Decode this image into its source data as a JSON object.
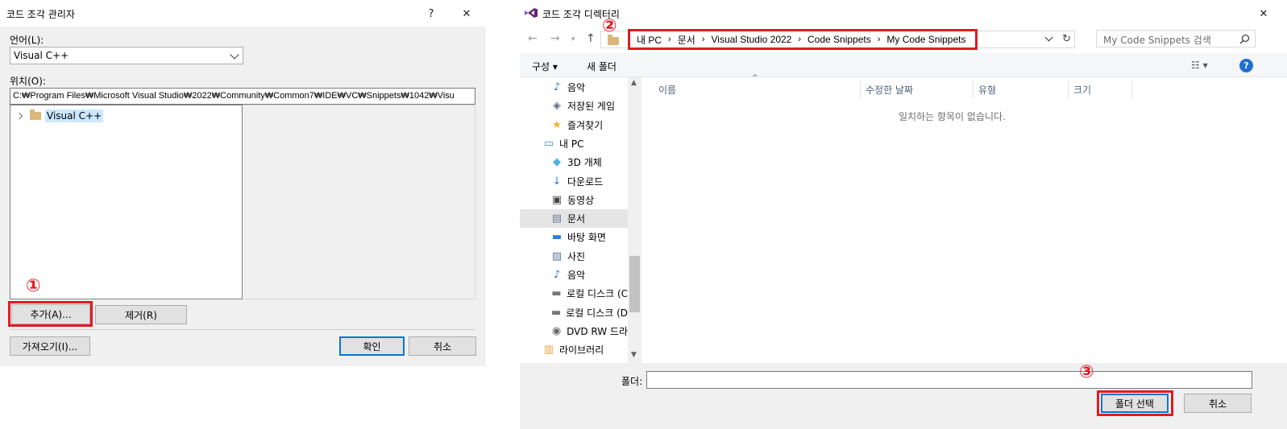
{
  "left_dialog": {
    "title": "코드 조각 관리자",
    "help_glyph": "?",
    "close_glyph": "✕",
    "language_label": "언어(L):",
    "language_value": "Visual C++",
    "location_label": "위치(O):",
    "location_path": "C:₩Program Files₩Microsoft Visual Studio₩2022₩Community₩Common7₩IDE₩VC₩Snippets₩1042₩Visu",
    "tree_item": "Visual C++",
    "add_button": "추가(A)...",
    "remove_button": "제거(R)",
    "import_button": "가져오기(I)...",
    "ok_button": "확인",
    "cancel_button": "취소"
  },
  "right_dialog": {
    "title": "코드 조각 디렉터리",
    "close_glyph": "✕",
    "breadcrumb": [
      "내 PC",
      "문서",
      "Visual Studio 2022",
      "Code Snippets",
      "My Code Snippets"
    ],
    "search_placeholder": "My Code Snippets 검색",
    "organize": "구성 ▾",
    "new_folder": "새 폴더",
    "help_glyph": "?",
    "nav_items": [
      {
        "label": "음악",
        "icon": "music-icon"
      },
      {
        "label": "저장된 게임",
        "icon": "gamepad-icon"
      },
      {
        "label": "즐겨찾기",
        "icon": "star-icon"
      },
      {
        "label": "내 PC",
        "icon": "computer-icon"
      },
      {
        "label": "3D 개체",
        "icon": "cube-icon"
      },
      {
        "label": "다운로드",
        "icon": "download-icon"
      },
      {
        "label": "동영상",
        "icon": "video-icon"
      },
      {
        "label": "문서",
        "icon": "document-icon"
      },
      {
        "label": "바탕 화면",
        "icon": "desktop-icon"
      },
      {
        "label": "사진",
        "icon": "picture-icon"
      },
      {
        "label": "음악",
        "icon": "music-icon"
      },
      {
        "label": "로컬 디스크 (C",
        "icon": "disk-icon"
      },
      {
        "label": "로컬 디스크 (D",
        "icon": "disk-icon"
      },
      {
        "label": "DVD RW 드라",
        "icon": "dvd-icon"
      },
      {
        "label": "라이브러리",
        "icon": "library-icon"
      }
    ],
    "columns": [
      "이름",
      "수정한 날짜",
      "유형",
      "크기"
    ],
    "empty_message": "일치하는 항목이 없습니다.",
    "folder_label": "폴더:",
    "folder_value": "",
    "select_folder_button": "폴더 선택",
    "cancel_button": "취소"
  },
  "annotations": {
    "step1": "①",
    "step2": "②",
    "step3": "③"
  },
  "colors": {
    "annotation_red": "#e01b22",
    "selection_blue": "#cce8ff",
    "accent_blue": "#0078d7"
  }
}
